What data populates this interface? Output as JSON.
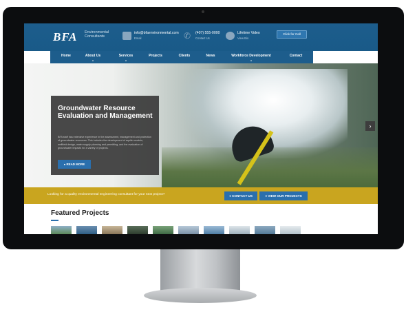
{
  "header": {
    "logo": "BFA",
    "logo_sub": "Environmental Consultants",
    "email": "info@bfaenvironmental.com",
    "email_sub": "Email",
    "phone": "(407) 555-0000",
    "phone_sub": "Contact Us",
    "video": "Lifetime Video",
    "video_sub": "View Bio",
    "click_call": "Click for Call"
  },
  "nav": [
    "Home",
    "About Us",
    "Services",
    "Projects",
    "Clients",
    "News",
    "Workforce Development",
    "Contact"
  ],
  "hero": {
    "title": "Groundwater Resource Evaluation and Management",
    "description": "BFA staff has extensive experience in the assessment, management and protection of groundwater resources. This includes the development of aquifer models, wellfield design, water supply planning and permitting, and the evaluation of groundwater impacts for a variety of projects.",
    "read_more": "READ MORE",
    "next_arrow": "›"
  },
  "banner": {
    "text": "Looking for a quality environmental engineering consultant for your next project?",
    "contact_button": "CONTACT US",
    "projects_button": "VIEW OUR PROJECTS"
  },
  "featured": {
    "title": "Featured Projects"
  },
  "colors": {
    "header_blue": "#1d5d8c",
    "accent_blue": "#2a6fad",
    "banner_gold": "#c9a51f",
    "hero_box": "#3a3a3a"
  }
}
